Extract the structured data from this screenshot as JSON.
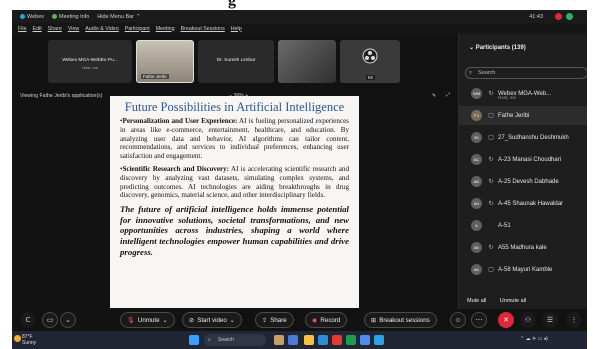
{
  "app": {
    "name": "Webex",
    "meeting_info": "Meeting Info",
    "hide_menu": "Hide Menu Bar",
    "time": "41:43"
  },
  "menu": [
    "File",
    "Edit",
    "Share",
    "View",
    "Audio & Video",
    "Participant",
    "Meeting",
    "Breakout Sessions",
    "Help"
  ],
  "videos": [
    {
      "name": "Webex MGA-WebEx-Pu...",
      "sub": "Host, me",
      "label": ""
    },
    {
      "name": "",
      "sub": "",
      "label": "Fathe Jeribi"
    },
    {
      "name": "Dr. Suresh Limbar",
      "sub": "",
      "label": ""
    },
    {
      "name": "",
      "sub": "",
      "label": ""
    },
    {
      "name": "",
      "sub": "",
      "label": "Mi"
    }
  ],
  "share": {
    "viewing": "Viewing Fathe Jeribi's application(s)",
    "zoom": "−  36%  +"
  },
  "slide": {
    "title": "Future Possibilities in Artificial Intelligence",
    "bullets": [
      {
        "heading": "Personalization and User Experience:",
        "text": " AI is fueling personalized experiences in areas like e-commerce, entertainment, healthcare, and education. By analyzing user data and behavior, AI algorithms can tailor content, recommendations, and services to individual preferences, enhancing user satisfaction and engagement."
      },
      {
        "heading": "Scientific Research and Discovery:",
        "text": " AI is accelerating scientific research and discovery by analyzing vast datasets, simulating complex systems, and predicting outcomes. AI technologies are aiding breakthroughs in drug discovery, genomics, material science, and other interdisciplinary fields."
      }
    ],
    "conclusion": "The future of artificial intelligence holds immense potential for innovative solutions, societal transformations, and new opportunities across industries, shaping a world where intelligent technologies empower human capabilities and drive progress."
  },
  "participants": {
    "header": "Participants (139)",
    "search_placeholder": "Search",
    "list": [
      {
        "initials": "WM",
        "icon": "↻",
        "name": "Webex MGA-Web...",
        "sub": "Host, me"
      },
      {
        "initials": "FJ",
        "icon": "▢",
        "name": "Fathe Jeribi",
        "sub": ""
      },
      {
        "initials": "2D",
        "icon": "▢",
        "name": "27_Sudhanshu Deshmukh",
        "sub": ""
      },
      {
        "initials": "AC",
        "icon": "↻",
        "name": "A-23 Manasi Choudhari",
        "sub": ""
      },
      {
        "initials": "AD",
        "icon": "↻",
        "name": "A-25 Devesh Dabhade",
        "sub": ""
      },
      {
        "initials": "AH",
        "icon": "↻",
        "name": "A-45 Shaunak Hawaldar",
        "sub": ""
      },
      {
        "initials": "A",
        "icon": "",
        "name": "A-51",
        "sub": ""
      },
      {
        "initials": "AK",
        "icon": "↻",
        "name": "A55 Madhura kale",
        "sub": ""
      },
      {
        "initials": "AK",
        "icon": "▢",
        "name": "A-58 Mayuri Kamble",
        "sub": ""
      }
    ],
    "mute_all": "Mute all",
    "unmute_all": "Unmute all"
  },
  "controls": {
    "unmute": "Unmute",
    "start_video": "Start video",
    "share": "Share",
    "record": "Record",
    "breakout": "Breakout sessions"
  },
  "taskbar": {
    "temp": "87°F",
    "weather": "Sunny",
    "search": "Search"
  },
  "colors": {
    "slide_title": "#2e5597",
    "end_call": "#e0283a",
    "app_bg": "#121212"
  }
}
